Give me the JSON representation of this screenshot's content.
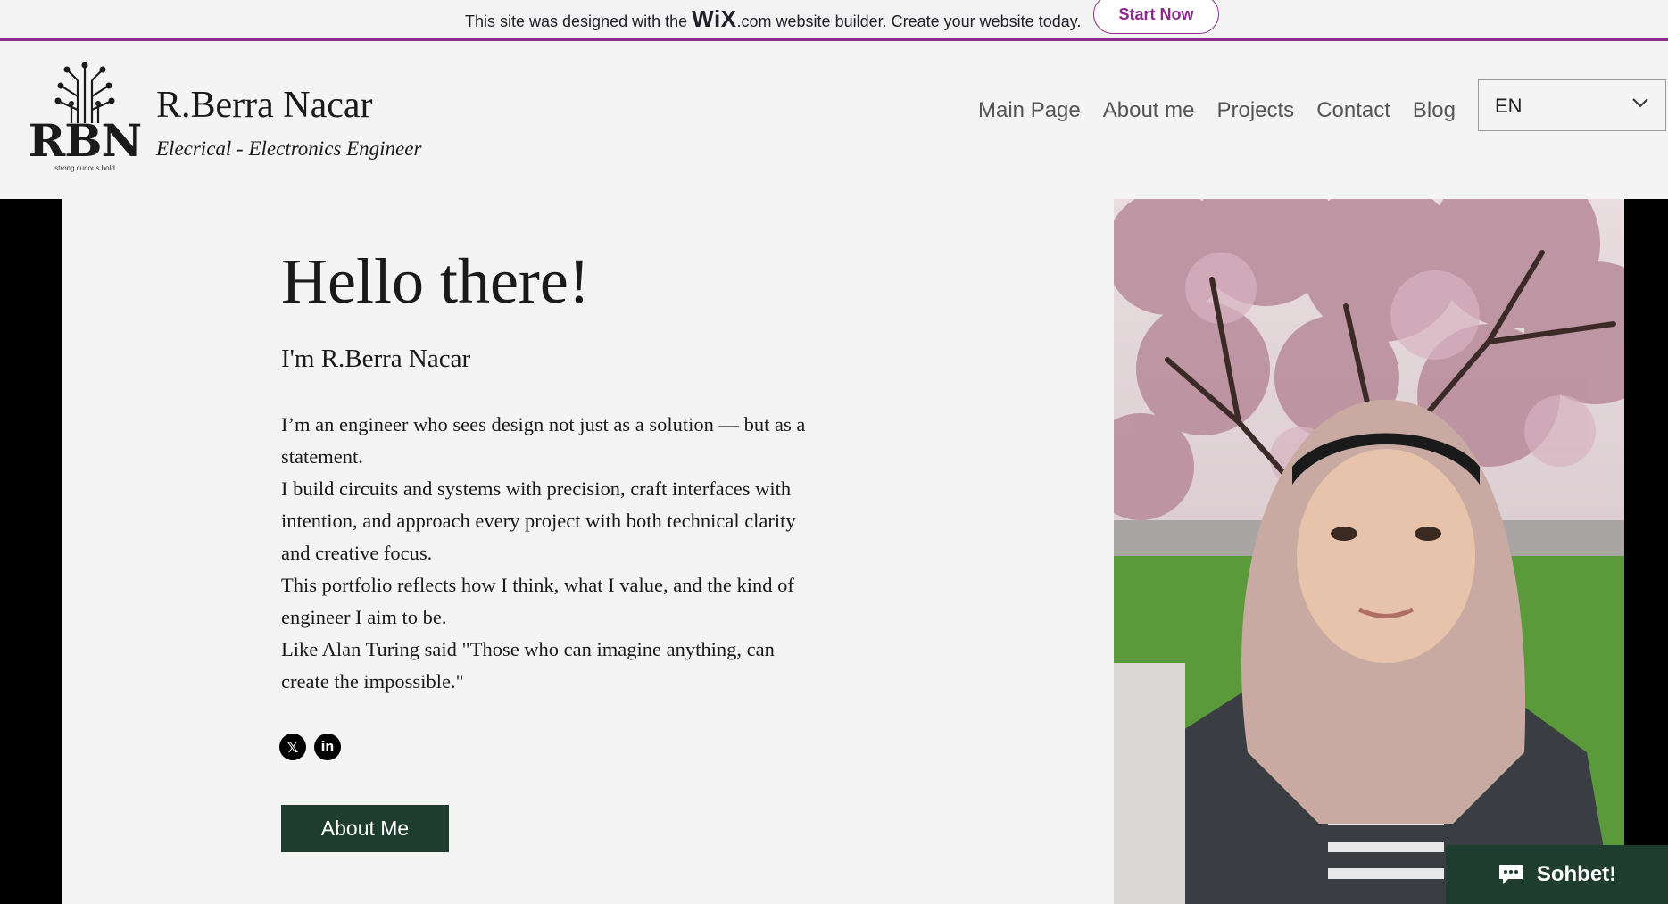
{
  "wix_banner": {
    "text_before": "This site was designed with the ",
    "logo": "WiX",
    "text_after": ".com website builder. Create your website today.",
    "cta": "Start Now"
  },
  "header": {
    "logo_letters": "RBN",
    "logo_tagline": "strong curious bold",
    "site_name": "R.Berra Nacar",
    "subtitle": "Elecrical - Electronics Engineer",
    "nav": [
      "Main Page",
      "About me",
      "Projects",
      "Contact",
      "Blog"
    ],
    "language": "EN"
  },
  "hero": {
    "title": "Hello there!",
    "intro": "I'm R.Berra Nacar",
    "paragraphs": [
      "I’m an engineer who sees design not just as a solution — but as a statement.",
      "I build circuits and systems with precision, craft interfaces with intention, and approach every project with both technical clarity and creative focus.",
      "This portfolio reflects how I think, what I value, and the kind of engineer I aim to be.",
      "Like Alan Turing said \"Those who can imagine anything, can create the impossible.\""
    ],
    "social_icons": [
      "x-icon",
      "linkedin-icon"
    ],
    "button": "About Me"
  },
  "chat": {
    "label": "Sohbet!"
  },
  "colors": {
    "wix_accent": "#8a2a8c",
    "button_green": "#1f3d2e"
  }
}
